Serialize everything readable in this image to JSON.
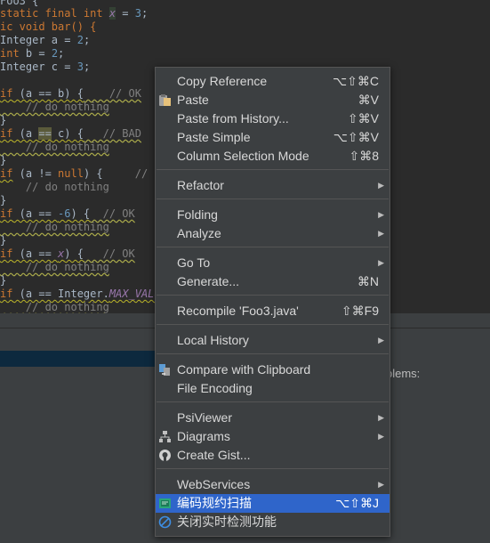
{
  "code": {
    "l0": "Foo3 {",
    "l1a": "static final int ",
    "l1b": "x",
    "l1c": " = ",
    "l1d": "3",
    "l1e": ";",
    "l2": "ic void bar() {",
    "l3a": "Integer a = ",
    "l3b": "2",
    "l3c": ";",
    "l4a": "int",
    "l4b": " b = ",
    "l4c": "2",
    "l4d": ";",
    "l5a": "Integer c = ",
    "l5b": "3",
    "l5c": ";",
    "l6a": "if",
    "l6b": " (a == b) {",
    "l6c": "    // OK",
    "l7": "    // do nothing",
    "l8": "}",
    "l9a": "if",
    "l9b": " (a ",
    "l9c": "==",
    "l9d": " c) {",
    "l9e": "   // BAD",
    "l10": "    // do nothing",
    "l11": "}",
    "l12a": "if",
    "l12b": " (a != ",
    "l12c": "null",
    "l12d": ") {",
    "l12e": "     // OK",
    "l13": "    // do nothing",
    "l14": "}",
    "l15a": "if",
    "l15b": " (a == ",
    "l15c": "-6",
    "l15d": ") {",
    "l15e": "  // OK",
    "l16": "    // do nothing",
    "l17": "}",
    "l18a": "if",
    "l18b": " (a == ",
    "l18c": "x",
    "l18d": ") {",
    "l18e": "   // OK",
    "l19": "    // do nothing",
    "l20": "}",
    "l21a": "if",
    "l21b": " (a == Integer.",
    "l21c": "MAX_VALUE",
    "l22": "    // do nothing"
  },
  "problems_label": "blems:",
  "menu": {
    "copy_reference": "Copy Reference",
    "copy_reference_sc": "⌥⇧⌘C",
    "paste": "Paste",
    "paste_sc": "⌘V",
    "paste_history": "Paste from History...",
    "paste_history_sc": "⇧⌘V",
    "paste_simple": "Paste Simple",
    "paste_simple_sc": "⌥⇧⌘V",
    "column_mode": "Column Selection Mode",
    "column_mode_sc": "⇧⌘8",
    "refactor": "Refactor",
    "folding": "Folding",
    "analyze": "Analyze",
    "goto": "Go To",
    "generate": "Generate...",
    "generate_sc": "⌘N",
    "recompile": "Recompile 'Foo3.java'",
    "recompile_sc": "⇧⌘F9",
    "local_history": "Local History",
    "compare_clipboard": "Compare with Clipboard",
    "file_encoding": "File Encoding",
    "psiviewer": "PsiViewer",
    "diagrams": "Diagrams",
    "create_gist": "Create Gist...",
    "webservices": "WebServices",
    "scan": "编码规约扫描",
    "scan_sc": "⌥⇧⌘J",
    "close_detect": "关闭实时检测功能"
  },
  "colors": {
    "menu_bg": "#3c3f41",
    "selected_bg": "#2f65ca",
    "editor_bg": "#2b2b2b"
  }
}
